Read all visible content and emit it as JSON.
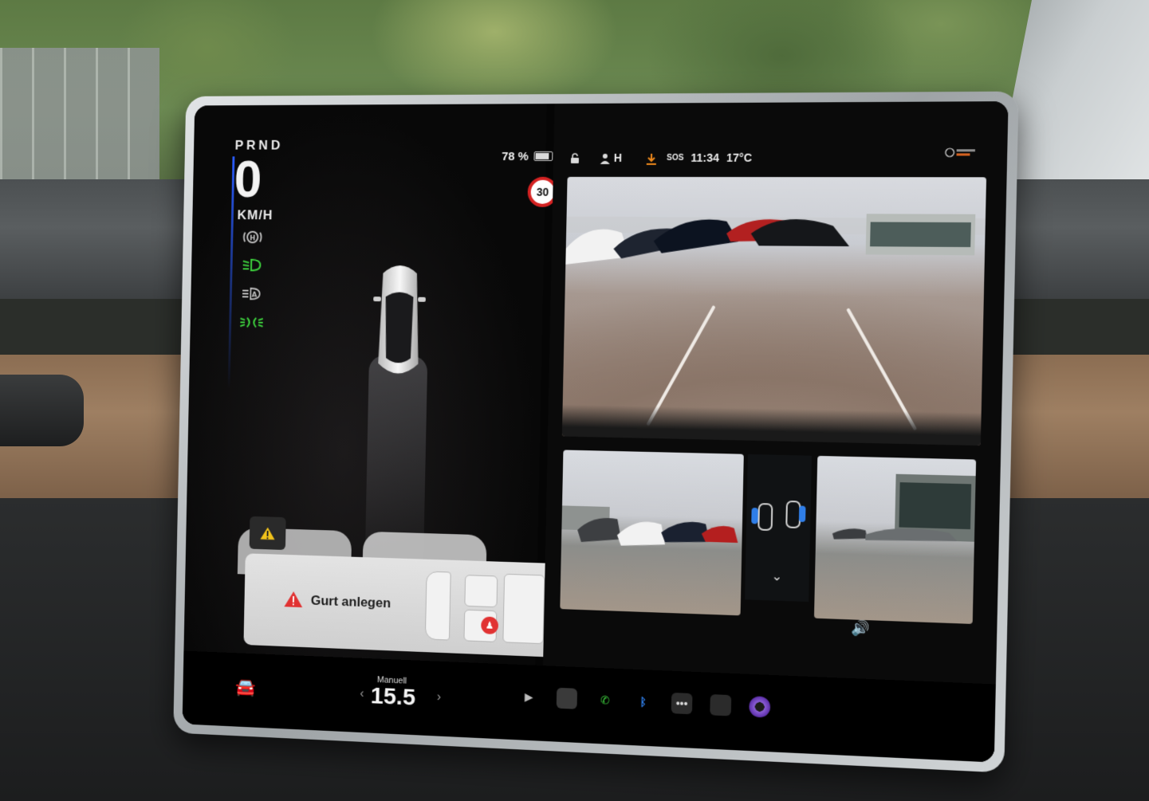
{
  "drive": {
    "gear": "PRND",
    "speed": "0",
    "speed_unit": "KM/H",
    "battery": "78 %",
    "speed_limit": "30"
  },
  "telltales": [
    {
      "name": "parking-brake-icon",
      "glyph": "(H)",
      "color": "#bdbdbd"
    },
    {
      "name": "low-beam-icon",
      "glyph": "≣D",
      "color": "#3ccc3c"
    },
    {
      "name": "auto-headlights-icon",
      "glyph": "≣A",
      "color": "#bdbdbd"
    },
    {
      "name": "parking-lights-icon",
      "glyph": "≡D≡",
      "color": "#3ccc3c"
    }
  ],
  "alert": {
    "message": "Gurt anlegen"
  },
  "status_bar": {
    "profile": "H",
    "sos": "SOS",
    "time": "11:34",
    "temperature": "17°C"
  },
  "climate": {
    "mode": "Manuell",
    "temperature": "15.5"
  },
  "colors": {
    "accent_blue": "#2f7ee8",
    "green": "#3ccc3c",
    "alert_red": "#e13232",
    "download_orange": "#f08a1c"
  }
}
